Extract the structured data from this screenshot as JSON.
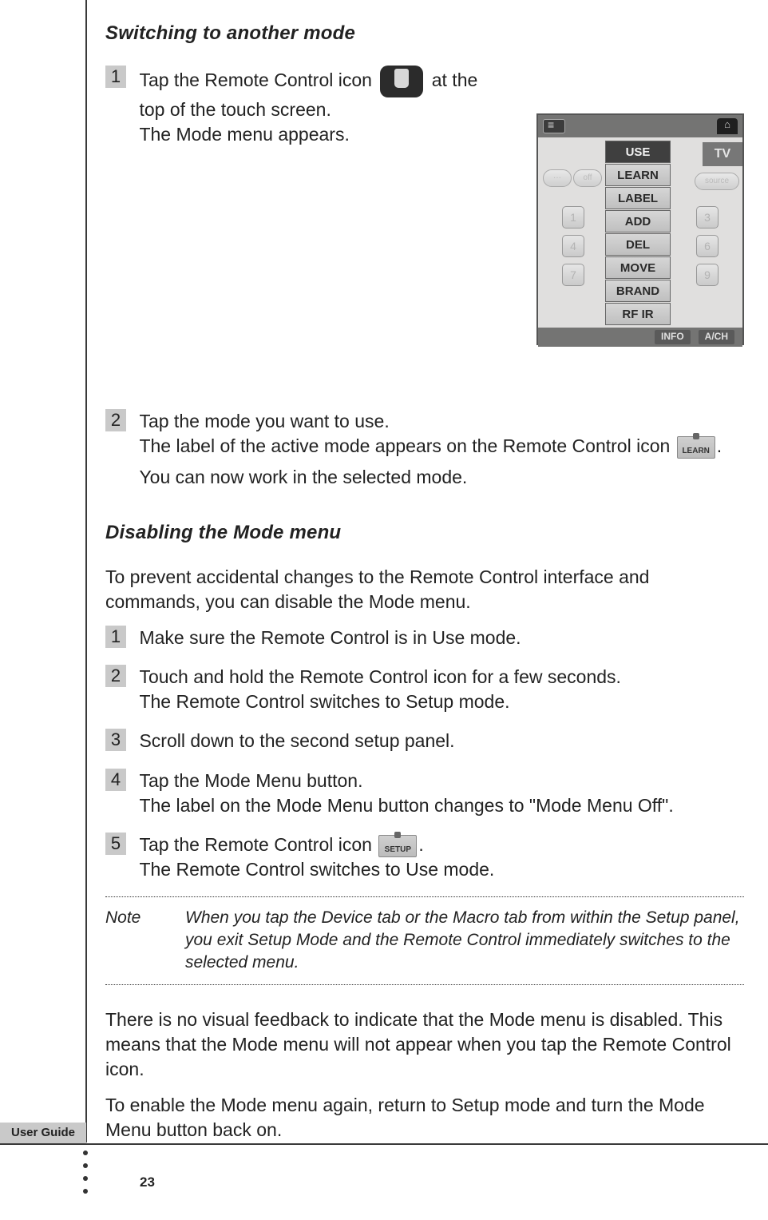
{
  "section1_title": "Switching to another mode",
  "section1": {
    "step1": {
      "num": "1",
      "line_a": "Tap the Remote Control icon ",
      "line_b": " at the top of the touch screen.",
      "sub": "The Mode menu appears."
    },
    "step2": {
      "num": "2",
      "line1": "Tap the mode you want to use.",
      "line2a": "The label of the active mode appears on the Remote Control icon ",
      "line2_icon_label": "LEARN",
      "line2b": ".",
      "line3": "You can now work in the selected mode."
    }
  },
  "figure": {
    "tv": "TV",
    "home": "⌂",
    "menu": [
      "USE",
      "LEARN",
      "LABEL",
      "ADD",
      "DEL",
      "MOVE",
      "BRAND",
      "RF IR"
    ],
    "left_pills": [
      "···",
      "off"
    ],
    "source_pill": "source",
    "num1": "1",
    "num3": "3",
    "num4": "4",
    "num6": "6",
    "num7": "7",
    "num9": "9",
    "bottom": [
      "INFO",
      "A/CH"
    ]
  },
  "section2_title": "Disabling the Mode menu",
  "section2_intro": "To prevent accidental changes to the Remote Control interface and commands, you can disable the Mode menu.",
  "section2_steps": {
    "s1": {
      "num": "1",
      "main": "Make sure the Remote Control is in Use mode."
    },
    "s2": {
      "num": "2",
      "main": "Touch and hold the Remote Control icon for a few seconds.",
      "sub": "The Remote Control switches to Setup mode."
    },
    "s3": {
      "num": "3",
      "main": "Scroll down to the second setup panel."
    },
    "s4": {
      "num": "4",
      "main": "Tap the Mode Menu button.",
      "sub": "The label on the Mode Menu button changes to \"Mode Menu Off\"."
    },
    "s5": {
      "num": "5",
      "main_a": "Tap the Remote Control icon ",
      "icon_label": "SETUP",
      "main_b": ".",
      "sub": "The Remote Control switches to Use mode."
    }
  },
  "note_label": "Note",
  "note_text": "When you tap the Device tab or the Macro tab from within the Setup panel, you exit Setup Mode and the Remote Control immediately switches to the selected menu.",
  "para1": "There is no visual feedback to indicate that the Mode menu is disabled. This means that the Mode menu will not appear when you tap the Remote Control icon.",
  "para2": "To enable the Mode menu again, return to Setup mode and turn the Mode Menu button back on.",
  "footer_tab": "User Guide",
  "page_number": "23"
}
